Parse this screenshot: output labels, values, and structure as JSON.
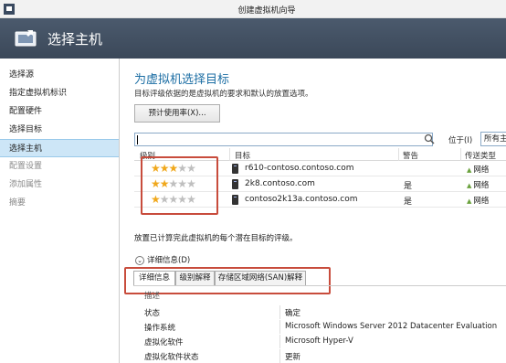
{
  "window": {
    "title": "创建虚拟机向导"
  },
  "header": {
    "title": "选择主机"
  },
  "sidebar": {
    "items": [
      {
        "label": "选择源",
        "state": "normal"
      },
      {
        "label": "指定虚拟机标识",
        "state": "normal"
      },
      {
        "label": "配置硬件",
        "state": "normal"
      },
      {
        "label": "选择目标",
        "state": "normal"
      },
      {
        "label": "选择主机",
        "state": "selected"
      },
      {
        "label": "配置设置",
        "state": "disabled"
      },
      {
        "label": "添加属性",
        "state": "disabled"
      },
      {
        "label": "摘要",
        "state": "disabled"
      }
    ]
  },
  "main": {
    "title": "为虚拟机选择目标",
    "description": "目标评级依据的是虚拟机的要求和默认的放置选项。",
    "estimate_button": "预计使用率(X)...",
    "search": {
      "value": "",
      "location_label": "位于(I)",
      "scope": "所有主"
    },
    "grid": {
      "columns": {
        "rating": "级别",
        "target": "目标",
        "warning": "警告",
        "transfer": "传送类型"
      },
      "rows": [
        {
          "stars": 3,
          "target": "r610-contoso.contoso.com",
          "warning": "",
          "transfer": "网络"
        },
        {
          "stars": 2,
          "target": "2k8.contoso.com",
          "warning": "是",
          "transfer": "网络"
        },
        {
          "stars": 1,
          "target": "contoso2k13a.contoso.com",
          "warning": "是",
          "transfer": "网络"
        }
      ]
    },
    "note": "放置已计算完此虚拟机的每个潜在目标的评级。",
    "details_toggle": "详细信息(D)",
    "tabs": [
      "详细信息",
      "级别解释",
      "存储区域网络(SAN)解释"
    ],
    "details": {
      "header": "描述",
      "rows": [
        {
          "key": "状态",
          "value": "确定"
        },
        {
          "key": "操作系统",
          "value": "Microsoft Windows Server 2012 Datacenter Evaluation"
        },
        {
          "key": "虚拟化软件",
          "value": "Microsoft Hyper-V"
        },
        {
          "key": "虚拟化软件状态",
          "value": "更新"
        }
      ]
    }
  },
  "colors": {
    "header_bg": "#3f4c5e",
    "accent": "#1c6ea4",
    "highlight": "#c84c3c",
    "star": "#f0a81c"
  }
}
